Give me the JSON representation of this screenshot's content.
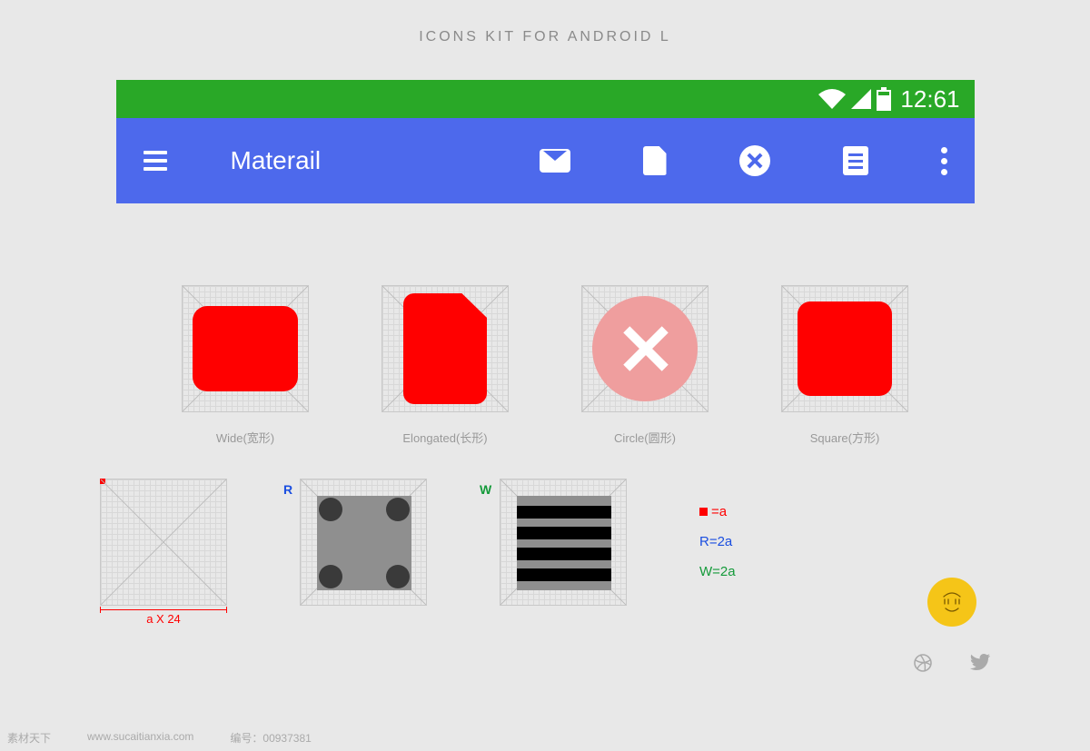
{
  "header": {
    "title": "ICONS KIT FOR ANDROID L"
  },
  "statusBar": {
    "time": "12:61"
  },
  "appBar": {
    "title": "Materail",
    "icons": [
      "mail-icon",
      "file-icon",
      "close-icon",
      "document-icon",
      "more-icon"
    ]
  },
  "shapes": [
    {
      "label": "Wide(宽形)"
    },
    {
      "label": "Elongated(长形)"
    },
    {
      "label": "Circle(圆形)"
    },
    {
      "label": "Square(方形)"
    }
  ],
  "scale": {
    "dimension": "a X 24",
    "r_label": "R",
    "w_label": "W"
  },
  "legend": {
    "a_eq": "=a",
    "r_eq": "R=2a",
    "w_eq": "W=2a"
  },
  "meta": {
    "site": "素材天下",
    "url": "www.sucaitianxia.com",
    "sn_label": "编号：",
    "sn": "00937381"
  }
}
